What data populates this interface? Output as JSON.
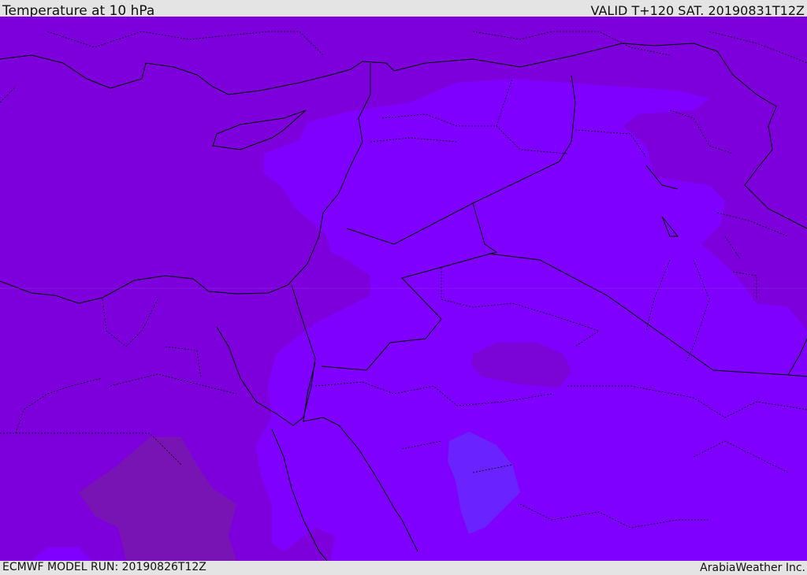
{
  "header": {
    "title": "Temperature at 10 hPa",
    "valid": "VALID T+120 SAT. 20190831T12Z"
  },
  "footer": {
    "model_run": "ECMWF MODEL RUN: 20190826T12Z",
    "credit": "ArabiaWeather Inc."
  },
  "colors": {
    "base": "#7d00dc",
    "warm": "#7f00ff",
    "cool": "#7813b4",
    "cold": "#6a22ff",
    "coast": "#000000"
  }
}
